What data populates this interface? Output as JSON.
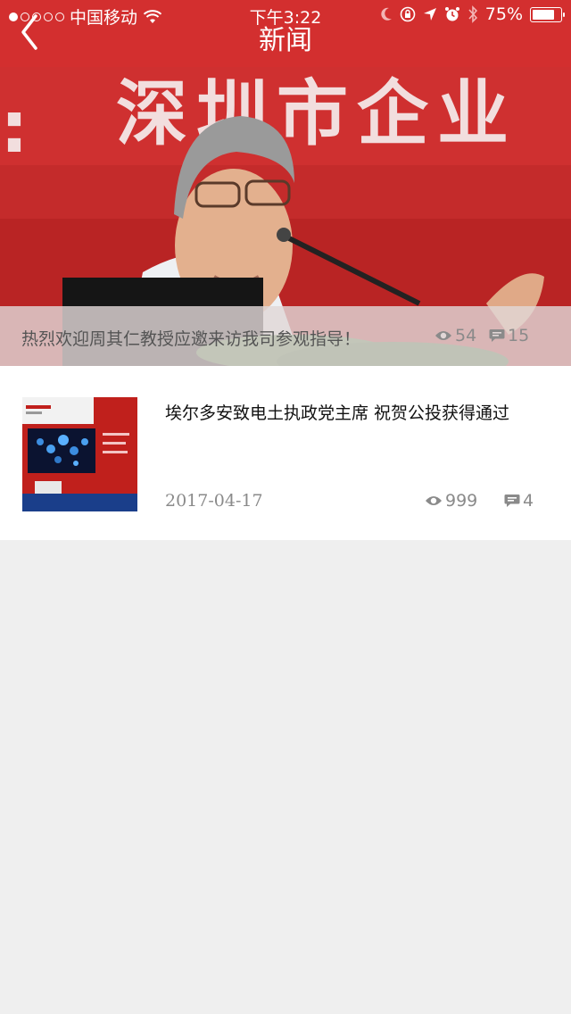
{
  "status_bar": {
    "carrier": "中国移动",
    "time": "下午3:22",
    "battery": "75%",
    "battery_level": 0.75
  },
  "header": {
    "title": "新闻",
    "back_icon": "chevron-left-icon"
  },
  "featured": {
    "caption": "热烈欢迎周其仁教授应邀来访我司参观指导！",
    "views": "54",
    "comments": "15",
    "backdrop_text": "深圳市企业"
  },
  "news_list": [
    {
      "title": "埃尔多安致电土执政党主席 祝贺公投获得通过",
      "date": "2017-04-17",
      "views": "999",
      "comments": "4"
    }
  ],
  "colors": {
    "header": "#d32f2f",
    "background": "#efefef",
    "meta": "#8a8a8a"
  }
}
